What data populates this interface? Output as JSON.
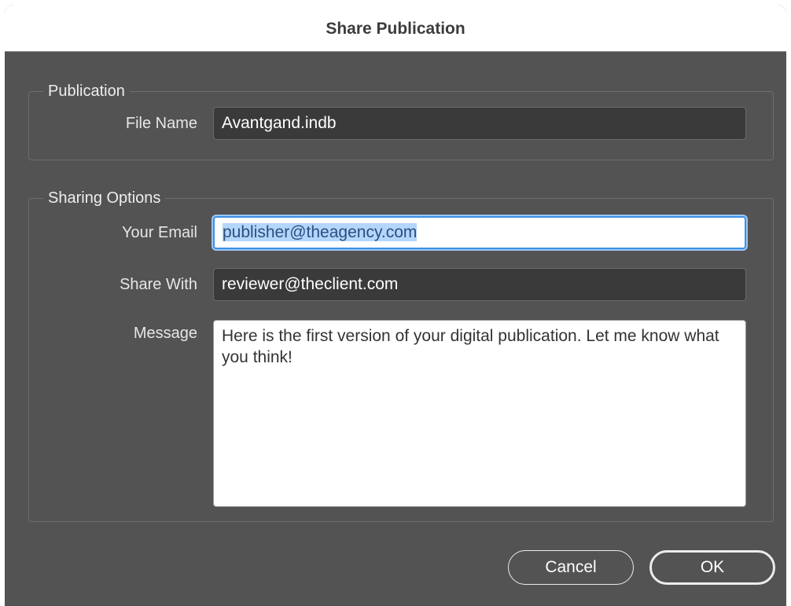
{
  "dialog": {
    "title": "Share Publication"
  },
  "publication": {
    "legend": "Publication",
    "file_name_label": "File Name",
    "file_name_value": "Avantgand.indb"
  },
  "sharing": {
    "legend": "Sharing Options",
    "email_label": "Your Email",
    "email_value": "publisher@theagency.com",
    "share_with_label": "Share With",
    "share_with_value": "reviewer@theclient.com",
    "message_label": "Message",
    "message_value": "Here is the first version of your digital publication. Let me know what you think!"
  },
  "buttons": {
    "cancel_label": "Cancel",
    "ok_label": "OK"
  },
  "colors": {
    "dialog_body": "#535353",
    "focus_ring": "#3b8fe6",
    "selection_highlight": "#b4d6fb"
  }
}
